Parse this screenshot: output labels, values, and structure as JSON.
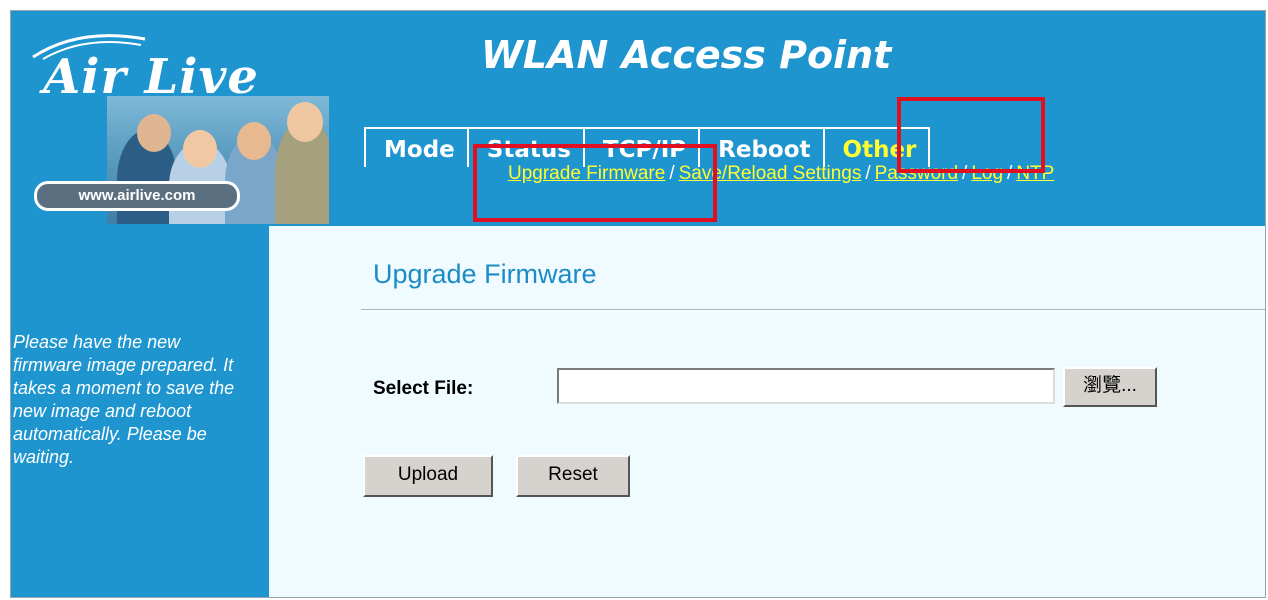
{
  "brand": {
    "logo_text": "Air Live",
    "website": "www.airlive.com"
  },
  "app_title": "WLAN Access Point",
  "tabs": [
    {
      "label": "Mode",
      "active": false
    },
    {
      "label": "Status",
      "active": false
    },
    {
      "label": "TCP/IP",
      "active": false
    },
    {
      "label": "Reboot",
      "active": false
    },
    {
      "label": "Other",
      "active": true
    }
  ],
  "subnav": {
    "items": [
      "Upgrade Firmware",
      "Save/Reload Settings",
      "Password",
      "Log",
      "NTP"
    ],
    "separator": "/"
  },
  "sidebar": {
    "help_text": "Please have the new firmware image prepared. It takes a moment to save the new image and reboot automatically. Please be waiting."
  },
  "main": {
    "title": "Upgrade Firmware",
    "select_file_label": "Select File:",
    "file_value": "",
    "browse_label": "瀏覽...",
    "upload_label": "Upload",
    "reset_label": "Reset"
  },
  "colors": {
    "header_blue": "#1e95cf",
    "active_tab": "#ffff33",
    "highlight_box": "#e01020",
    "content_bg": "#f0fbff",
    "title_blue": "#1c8bc6"
  }
}
